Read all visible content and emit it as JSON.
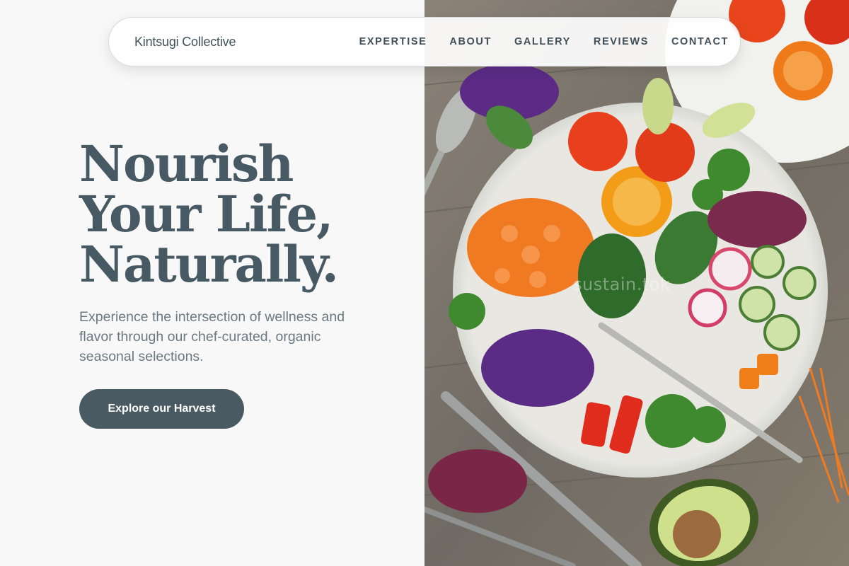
{
  "brand": {
    "name": "Kintsugi Collective"
  },
  "nav": {
    "links": [
      "EXPERTISE",
      "ABOUT",
      "GALLERY",
      "REVIEWS",
      "CONTACT"
    ]
  },
  "hero": {
    "headline_lines": [
      "Nourish",
      "Your Life,",
      "Naturally."
    ],
    "subtext": "Experience the intersection of wellness and flavor through our chef-curated, organic seasonal selections.",
    "cta_label": "Explore our Harvest"
  },
  "image": {
    "watermark": "sustain.tok",
    "subject": "overhead salad bowl on wooden table"
  },
  "colors": {
    "accent": "#4a5a63",
    "headline": "#475a63",
    "background": "#f8f8f8"
  }
}
